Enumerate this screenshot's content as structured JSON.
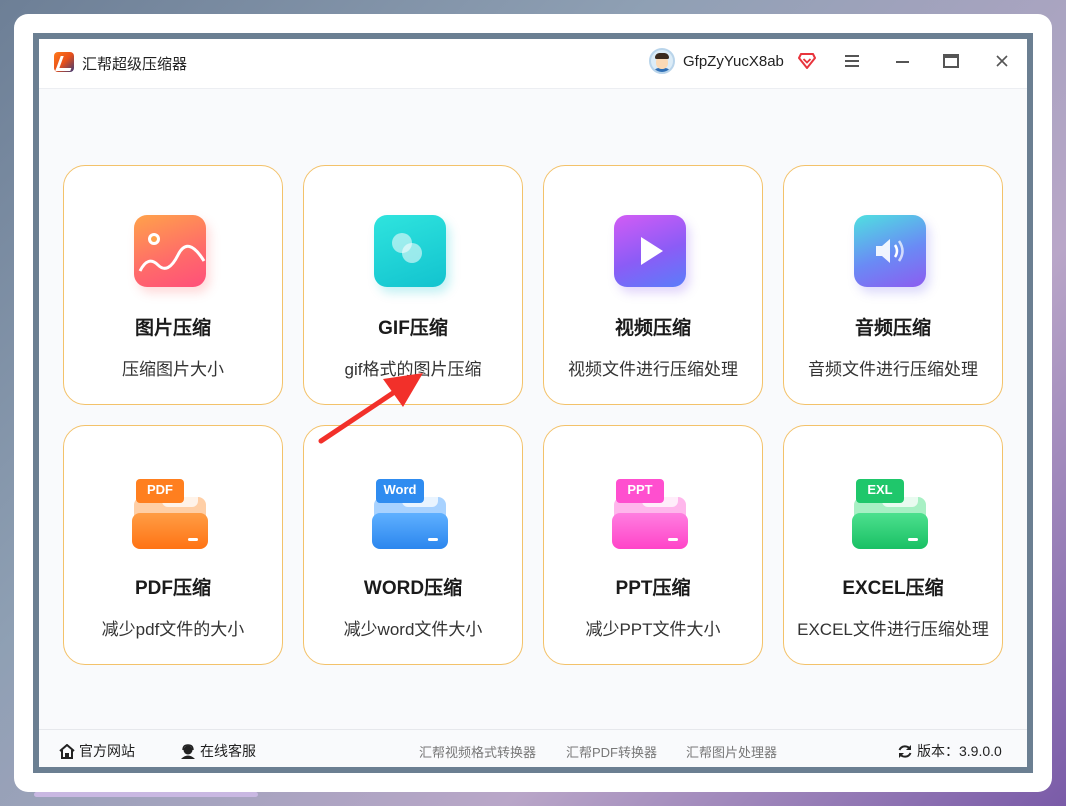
{
  "app": {
    "title": "汇帮超级压缩器"
  },
  "user": {
    "name": "GfpZyYucX8ab"
  },
  "tools": [
    {
      "title": "图片压缩",
      "desc": "压缩图片大小",
      "icon": "image-icon"
    },
    {
      "title": "GIF压缩",
      "desc": "gif格式的图片压缩",
      "icon": "gif-icon"
    },
    {
      "title": "视频压缩",
      "desc": "视频文件进行压缩处理",
      "icon": "video-icon"
    },
    {
      "title": "音频压缩",
      "desc": "音频文件进行压缩处理",
      "icon": "audio-icon"
    },
    {
      "title": "PDF压缩",
      "desc": "减少pdf文件的大小",
      "icon": "pdf-folder-icon",
      "badge": "PDF"
    },
    {
      "title": "WORD压缩",
      "desc": "减少word文件大小",
      "icon": "word-folder-icon",
      "badge": "Word"
    },
    {
      "title": "PPT压缩",
      "desc": "减少PPT文件大小",
      "icon": "ppt-folder-icon",
      "badge": "PPT"
    },
    {
      "title": "EXCEL压缩",
      "desc": "EXCEL文件进行压缩处理",
      "icon": "excel-folder-icon",
      "badge": "EXL"
    }
  ],
  "footer": {
    "website": "官方网站",
    "service": "在线客服",
    "links": [
      "汇帮视频格式转换器",
      "汇帮PDF转换器",
      "汇帮图片处理器"
    ],
    "version": "版本：3.9.0.0"
  },
  "colors": {
    "card_border": "#f3c26a",
    "arrow": "#f2302a",
    "vip": "#e8343c"
  }
}
